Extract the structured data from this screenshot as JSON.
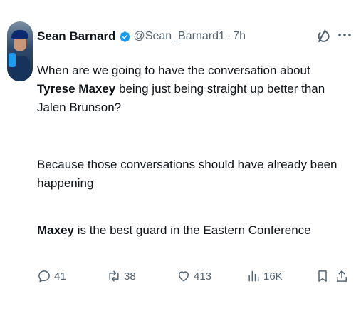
{
  "author": {
    "name": "Sean Barnard",
    "handle": "@Sean_Barnard1",
    "separator": "·",
    "time": "7h",
    "verified_color": "#1d9bf0"
  },
  "tweet": {
    "para1_pre": "When are we going to have the conversation about ",
    "para1_bold": "Tyrese Maxey",
    "para1_post": " being just being straight up better than Jalen Brunson?",
    "para2": "Because those conversations should have already been happening",
    "para3_bold": "Maxey",
    "para3_post": " is the best guard in the Eastern Conference"
  },
  "actions": {
    "replies": "41",
    "retweets": "38",
    "likes": "413",
    "views": "16K"
  },
  "icons": {
    "reply": "reply-icon",
    "retweet": "retweet-icon",
    "like": "heart-icon",
    "views": "views-icon",
    "bookmark": "bookmark-icon",
    "share": "share-icon",
    "grok": "grok-icon",
    "more": "more-icon",
    "verified": "verified-badge-icon"
  },
  "colors": {
    "text": "#0f1419",
    "muted": "#536471",
    "accent": "#1d9bf0"
  }
}
